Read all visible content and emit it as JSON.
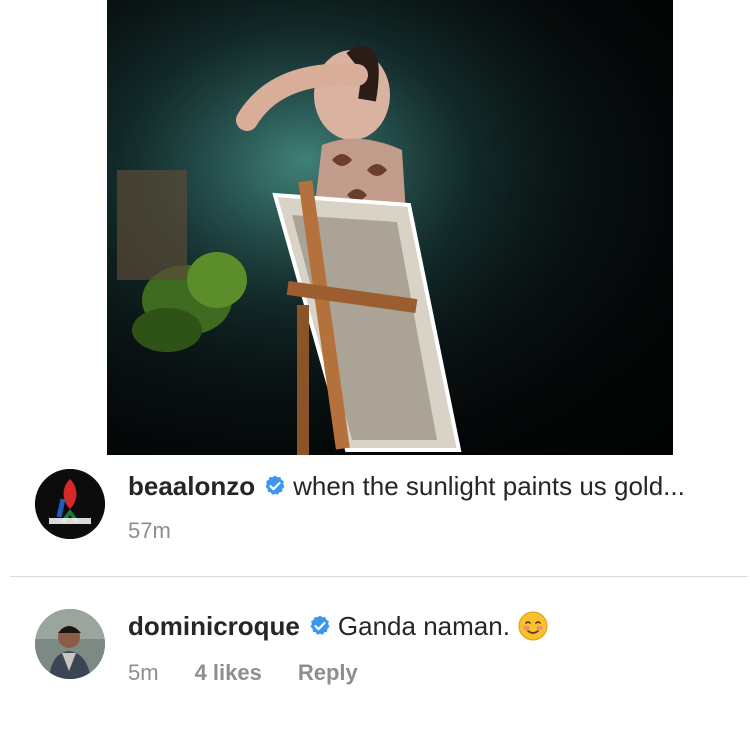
{
  "post": {
    "image_alt_icon": "photo",
    "caption": {
      "username": "beaalonzo",
      "verified": true,
      "text": "when the sunlight paints us gold...",
      "time": "57m",
      "avatar_logo": "ABS-CBN"
    }
  },
  "comments": [
    {
      "username": "dominicroque",
      "verified": true,
      "text": "Ganda naman.",
      "emoji": "smiling-blush-emoji",
      "time": "5m",
      "likes": "4 likes",
      "reply_label": "Reply"
    }
  ],
  "colors": {
    "verified_badge": "#3897f0",
    "username": "#262626",
    "meta": "#8e8e8e",
    "divider": "#dbdbdb"
  }
}
